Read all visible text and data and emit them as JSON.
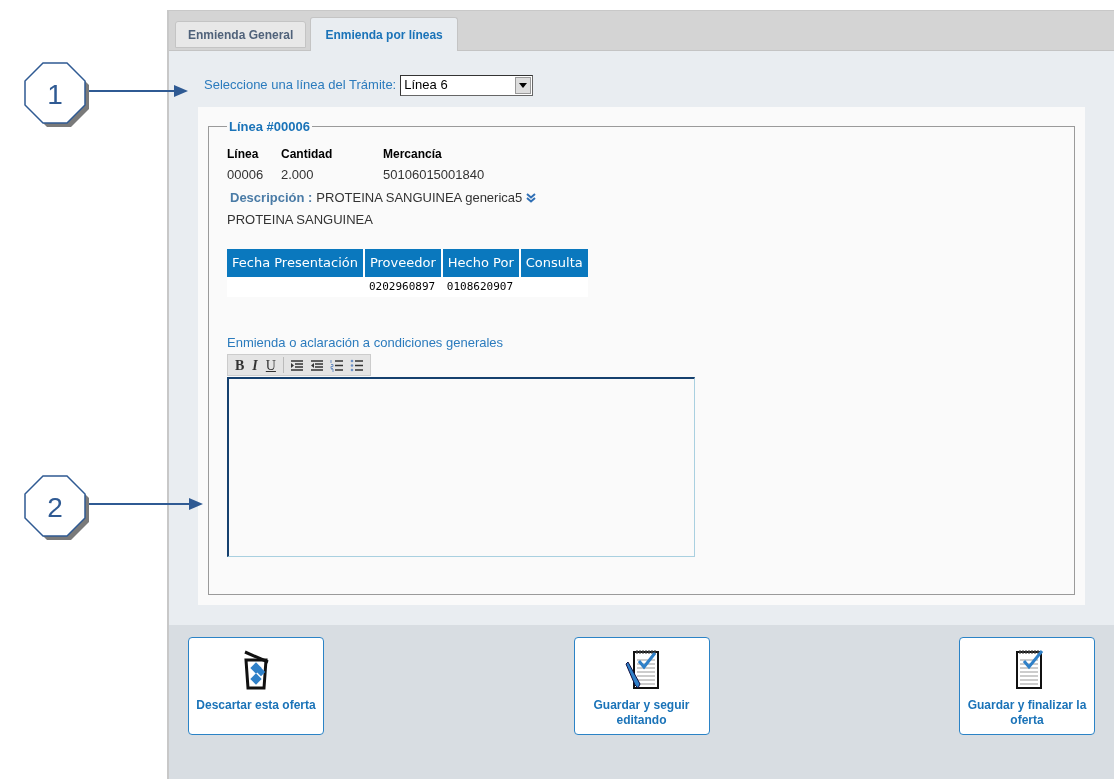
{
  "callouts": [
    "1",
    "2"
  ],
  "tabs": [
    {
      "label": "Enmienda General",
      "selected": false
    },
    {
      "label": "Enmienda por líneas",
      "selected": true
    }
  ],
  "line_selector": {
    "label": "Seleccione una línea del Trámite:",
    "value": "Línea 6"
  },
  "line_panel": {
    "legend": "Línea #00006",
    "fields": [
      {
        "label": "Línea",
        "value": "00006"
      },
      {
        "label": "Cantidad",
        "value": "2.000"
      },
      {
        "label": "Mercancía",
        "value": "50106015001840"
      }
    ],
    "description_label": "Descripción :",
    "description_value": "PROTEINA SANGUINEA generica5",
    "description_continued": "PROTEINA SANGUINEA",
    "history_columns": [
      {
        "header": "Fecha Presentación"
      },
      {
        "header": "Proveedor",
        "value": "0202960897"
      },
      {
        "header": "Hecho Por",
        "value": "0108620907"
      },
      {
        "header": "Consulta"
      }
    ],
    "editor": {
      "label": "Enmienda o aclaración a condiciones generales",
      "toolbar": [
        {
          "kind": "bold",
          "label": "B"
        },
        {
          "kind": "italic",
          "label": "I"
        },
        {
          "kind": "underline",
          "label": "U"
        },
        {
          "kind": "indent"
        },
        {
          "kind": "outdent"
        },
        {
          "kind": "ordered-list"
        },
        {
          "kind": "bullet-list"
        }
      ]
    }
  },
  "buttons": [
    {
      "kind": "discard",
      "label": "Descartar esta oferta"
    },
    {
      "kind": "save-continue",
      "label": "Guardar y seguir editando"
    },
    {
      "kind": "save-finish",
      "label": "Guardar y finalizar la oferta"
    }
  ]
}
